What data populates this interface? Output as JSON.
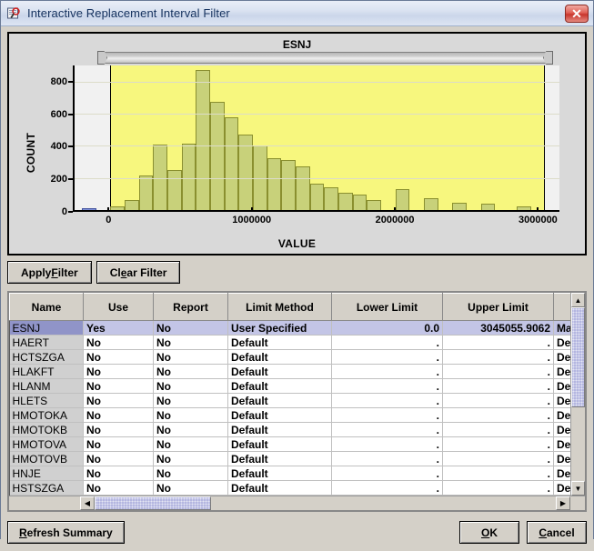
{
  "window": {
    "title": "Interactive Replacement Interval Filter",
    "icon": "filter-document-icon",
    "close_label": "✕"
  },
  "chart_data": {
    "type": "bar",
    "title": "ESNJ",
    "xlabel": "VALUE",
    "ylabel": "COUNT",
    "xlim": [
      -250000,
      3150000
    ],
    "ylim": [
      0,
      900
    ],
    "yticks": [
      0,
      200,
      400,
      600,
      800
    ],
    "xticks": [
      0,
      1000000,
      2000000,
      3000000
    ],
    "grid": true,
    "legend": "none",
    "selection": {
      "lower": 0,
      "upper": 3045055.9062
    },
    "bin_width": 100000,
    "bars": [
      {
        "x": -150000,
        "value": 12,
        "inside": false
      },
      {
        "x": 50000,
        "value": 22,
        "inside": true
      },
      {
        "x": 150000,
        "value": 60,
        "inside": true
      },
      {
        "x": 250000,
        "value": 215,
        "inside": true
      },
      {
        "x": 350000,
        "value": 408,
        "inside": true
      },
      {
        "x": 450000,
        "value": 250,
        "inside": true
      },
      {
        "x": 550000,
        "value": 413,
        "inside": true
      },
      {
        "x": 650000,
        "value": 870,
        "inside": true
      },
      {
        "x": 750000,
        "value": 672,
        "inside": true
      },
      {
        "x": 850000,
        "value": 575,
        "inside": true
      },
      {
        "x": 950000,
        "value": 470,
        "inside": true
      },
      {
        "x": 1050000,
        "value": 400,
        "inside": true
      },
      {
        "x": 1150000,
        "value": 322,
        "inside": true
      },
      {
        "x": 1250000,
        "value": 310,
        "inside": true
      },
      {
        "x": 1350000,
        "value": 272,
        "inside": true
      },
      {
        "x": 1450000,
        "value": 162,
        "inside": true
      },
      {
        "x": 1550000,
        "value": 142,
        "inside": true
      },
      {
        "x": 1650000,
        "value": 105,
        "inside": true
      },
      {
        "x": 1750000,
        "value": 95,
        "inside": true
      },
      {
        "x": 1850000,
        "value": 62,
        "inside": true
      },
      {
        "x": 2050000,
        "value": 128,
        "inside": true
      },
      {
        "x": 2250000,
        "value": 72,
        "inside": true
      },
      {
        "x": 2450000,
        "value": 45,
        "inside": true
      },
      {
        "x": 2650000,
        "value": 42,
        "inside": true
      },
      {
        "x": 2900000,
        "value": 22,
        "inside": true
      }
    ]
  },
  "filter_buttons": {
    "apply": {
      "pre": "Apply ",
      "key": "F",
      "post": "ilter"
    },
    "clear": {
      "pre": "Cl",
      "key": "e",
      "post": "ar Filter"
    }
  },
  "table": {
    "columns": [
      "Name",
      "Use",
      "Report",
      "Limit Method",
      "Lower Limit",
      "Upper Limit",
      ""
    ],
    "rows": [
      {
        "name": "ESNJ",
        "use": "Yes",
        "report": "No",
        "method": "User Specified",
        "lower": "0.0",
        "upper": "3045055.9062",
        "extra": "Ma",
        "selected": true
      },
      {
        "name": "HAERT",
        "use": "No",
        "report": "No",
        "method": "Default",
        "lower": ".",
        "upper": ".",
        "extra": "De",
        "selected": false
      },
      {
        "name": "HCTSZGA",
        "use": "No",
        "report": "No",
        "method": "Default",
        "lower": ".",
        "upper": ".",
        "extra": "De",
        "selected": false
      },
      {
        "name": "HLAKFT",
        "use": "No",
        "report": "No",
        "method": "Default",
        "lower": ".",
        "upper": ".",
        "extra": "De",
        "selected": false
      },
      {
        "name": "HLANM",
        "use": "No",
        "report": "No",
        "method": "Default",
        "lower": ".",
        "upper": ".",
        "extra": "De",
        "selected": false
      },
      {
        "name": "HLETS",
        "use": "No",
        "report": "No",
        "method": "Default",
        "lower": ".",
        "upper": ".",
        "extra": "De",
        "selected": false
      },
      {
        "name": "HMOTOKA",
        "use": "No",
        "report": "No",
        "method": "Default",
        "lower": ".",
        "upper": ".",
        "extra": "De",
        "selected": false
      },
      {
        "name": "HMOTOKB",
        "use": "No",
        "report": "No",
        "method": "Default",
        "lower": ".",
        "upper": ".",
        "extra": "De",
        "selected": false
      },
      {
        "name": "HMOTOVA",
        "use": "No",
        "report": "No",
        "method": "Default",
        "lower": ".",
        "upper": ".",
        "extra": "De",
        "selected": false
      },
      {
        "name": "HMOTOVB",
        "use": "No",
        "report": "No",
        "method": "Default",
        "lower": ".",
        "upper": ".",
        "extra": "De",
        "selected": false
      },
      {
        "name": "HNJE",
        "use": "No",
        "report": "No",
        "method": "Default",
        "lower": ".",
        "upper": ".",
        "extra": "De",
        "selected": false
      },
      {
        "name": "HSTSZGA",
        "use": "No",
        "report": "No",
        "method": "Default",
        "lower": ".",
        "upper": ".",
        "extra": "De",
        "selected": false
      }
    ]
  },
  "scrollbars": {
    "up_arrow": "▲",
    "down_arrow": "▼",
    "left_arrow": "◀",
    "right_arrow": "▶"
  },
  "footer": {
    "refresh": {
      "pre": "",
      "key": "R",
      "post": "efresh Summary"
    },
    "ok": {
      "pre": "",
      "key": "O",
      "post": "K"
    },
    "cancel": {
      "pre": "",
      "key": "C",
      "post": "ancel"
    }
  },
  "colors": {
    "selection_band": "#f7f77e",
    "bar_fill": "#c8d17a",
    "bar_border": "#8a8f2f",
    "bar_outside": "#7d8fd8",
    "row_selected": "#c3c5e6",
    "scroll_thumb": "#b4b6e0"
  }
}
